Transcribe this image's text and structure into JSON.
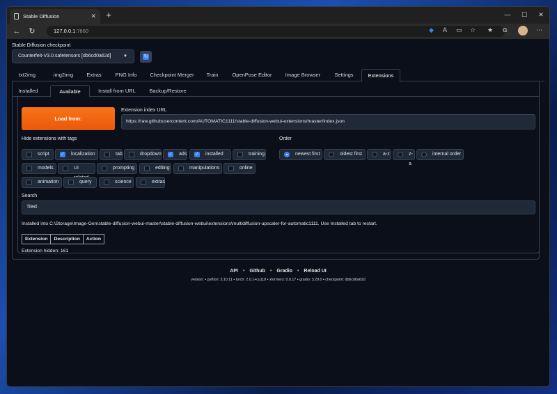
{
  "browser": {
    "tab_title": "Stable Diffusion",
    "url_host": "127.0.0.1",
    "url_port": ":7860"
  },
  "checkpoint": {
    "label": "Stable Diffusion checkpoint",
    "value": "Counterfeit-V3.0.safetensors [db6cd0a62d]"
  },
  "main_tabs": [
    "txt2img",
    "img2img",
    "Extras",
    "PNG Info",
    "Checkpoint Merger",
    "Train",
    "OpenPose Editor",
    "Image Browser",
    "Settings",
    "Extensions"
  ],
  "sub_tabs": [
    "Installed",
    "Available",
    "Install from URL",
    "Backup/Restore"
  ],
  "load_button": "Load from:",
  "index_url": {
    "label": "Extension index URL",
    "value": "https://raw.githubusercontent.com/AUTOMATIC1111/stable-diffusion-webui-extensions/master/index.json"
  },
  "hide_tags": {
    "label": "Hide extensions with tags",
    "items": [
      {
        "label": "script",
        "checked": false
      },
      {
        "label": "localization",
        "checked": true
      },
      {
        "label": "tab",
        "checked": false
      },
      {
        "label": "dropdown",
        "checked": false
      },
      {
        "label": "ads",
        "checked": true
      },
      {
        "label": "installed",
        "checked": true
      },
      {
        "label": "training",
        "checked": false
      },
      {
        "label": "models",
        "checked": false
      },
      {
        "label": "UI related",
        "checked": false
      },
      {
        "label": "prompting",
        "checked": false
      },
      {
        "label": "editing",
        "checked": false
      },
      {
        "label": "manipulations",
        "checked": false
      },
      {
        "label": "online",
        "checked": false
      },
      {
        "label": "animation",
        "checked": false
      },
      {
        "label": "query",
        "checked": false
      },
      {
        "label": "science",
        "checked": false
      },
      {
        "label": "extras",
        "checked": false
      }
    ]
  },
  "order": {
    "label": "Order",
    "options": [
      "newest first",
      "oldest first",
      "a-z",
      "z-a",
      "internal order"
    ],
    "selected": "newest first"
  },
  "search": {
    "label": "Search",
    "value": "Tiled"
  },
  "install_info": "Installed into C:\\Storage\\Image-Gen\\stable-diffusion-webui-master\\stable-diffusion-webui\\extensions\\multidiffusion-upscaler-for-automatic1111. Use Installed tab to restart.",
  "table_headers": [
    "Extension",
    "Description",
    "Action"
  ],
  "hidden_count": "Extension hidden: 161",
  "footer": {
    "links": [
      "API",
      "Github",
      "Gradio",
      "Reload UI"
    ],
    "version_line": "version:  •  python: 3.10.11  •  torch: 2.0.1+cu118  •  xformers: 0.0.17  •  gradio: 3.29.0  •  checkpoint: db6cd0a62d"
  }
}
